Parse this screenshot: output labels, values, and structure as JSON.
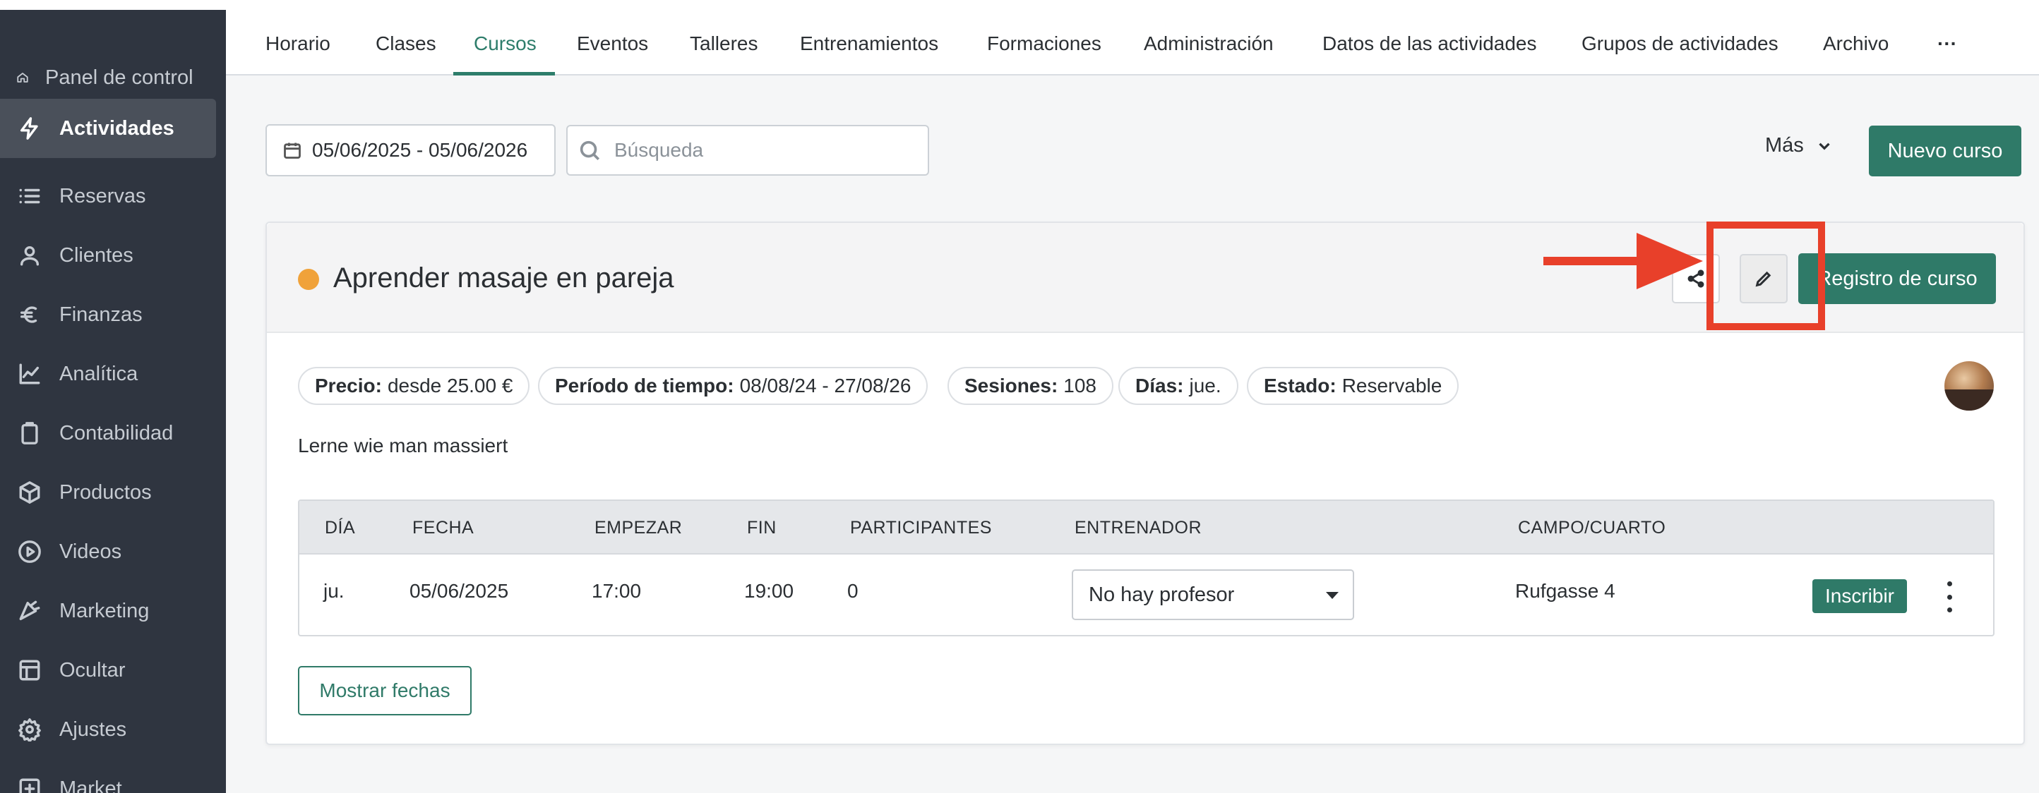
{
  "sidebar": {
    "items": [
      {
        "label": "Panel de control",
        "icon": "home-icon"
      },
      {
        "label": "Actividades",
        "icon": "bolt-icon",
        "active": true
      },
      {
        "label": "Reservas",
        "icon": "list-icon"
      },
      {
        "label": "Clientes",
        "icon": "user-icon"
      },
      {
        "label": "Finanzas",
        "icon": "euro-icon"
      },
      {
        "label": "Analítica",
        "icon": "chart-line-icon"
      },
      {
        "label": "Contabilidad",
        "icon": "clipboard-icon"
      },
      {
        "label": "Productos",
        "icon": "box-icon"
      },
      {
        "label": "Videos",
        "icon": "play-circle-icon"
      },
      {
        "label": "Marketing",
        "icon": "megaphone-icon"
      },
      {
        "label": "Ocultar",
        "icon": "layout-icon"
      },
      {
        "label": "Ajustes",
        "icon": "gear-icon"
      },
      {
        "label": "Market",
        "icon": "plus-square-icon"
      }
    ]
  },
  "tabs": [
    {
      "label": "Horario"
    },
    {
      "label": "Clases"
    },
    {
      "label": "Cursos",
      "active": true
    },
    {
      "label": "Eventos"
    },
    {
      "label": "Talleres"
    },
    {
      "label": "Entrenamientos"
    },
    {
      "label": "Formaciones"
    },
    {
      "label": "Administración"
    },
    {
      "label": "Datos de las actividades"
    },
    {
      "label": "Grupos de actividades"
    },
    {
      "label": "Archivo"
    },
    {
      "label": "···"
    }
  ],
  "toolbar": {
    "date_range": "05/06/2025 - 05/06/2026",
    "search_placeholder": "Búsqueda",
    "more_label": "Más",
    "new_course_label": "Nuevo curso"
  },
  "course": {
    "title": "Aprender masaje en pareja",
    "status_color": "#f0a23a",
    "register_label": "Registro de curso",
    "chips": [
      {
        "label": "Precio:",
        "value": "desde 25.00 €"
      },
      {
        "label": "Período de tiempo:",
        "value": "08/08/24 - 27/08/26"
      },
      {
        "label": "Sesiones:",
        "value": "108"
      },
      {
        "label": "Días:",
        "value": "jue."
      },
      {
        "label": "Estado:",
        "value": "Reservable"
      }
    ],
    "description": "Lerne wie man massiert",
    "table": {
      "headers": [
        "DÍA",
        "FECHA",
        "EMPEZAR",
        "FIN",
        "PARTICIPANTES",
        "ENTRENADOR",
        "CAMPO/CUARTO"
      ],
      "rows": [
        {
          "day": "ju.",
          "date": "05/06/2025",
          "start": "17:00",
          "end": "19:00",
          "participants": "0",
          "trainer": "No hay profesor",
          "room": "Rufgasse 4",
          "action": "Inscribir"
        }
      ]
    },
    "show_dates_label": "Mostrar fechas"
  },
  "colors": {
    "accent": "#2f7a68",
    "sidebar_bg": "#2f3540",
    "annotation": "#e8402a"
  }
}
